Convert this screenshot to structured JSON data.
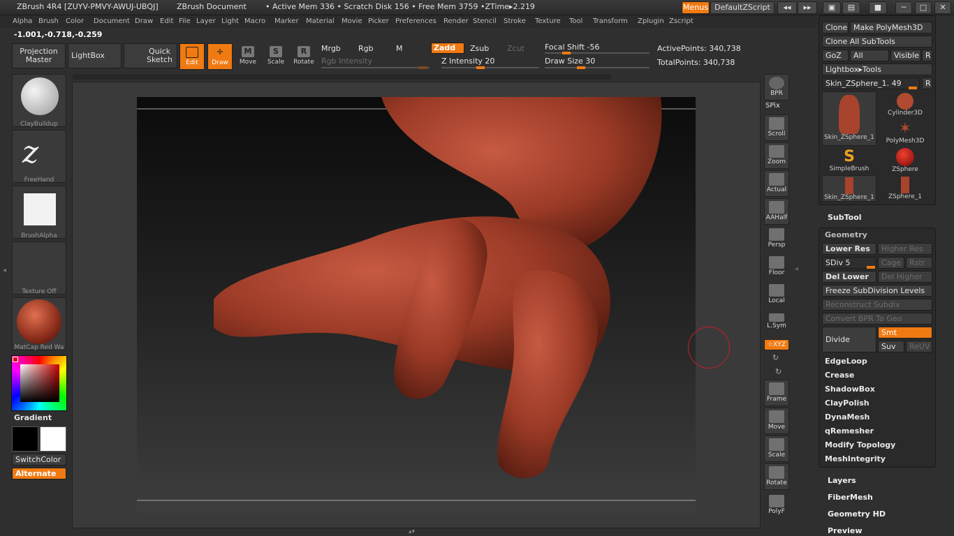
{
  "title": {
    "app": "ZBrush 4R4 [ZUYV-PMVY-AWUJ-UBQJ]",
    "doc": "ZBrush Document",
    "status": "• Active Mem 336 • Scratch Disk 156 • Free Mem 3759 •ZTime▸2.219"
  },
  "titlebar": {
    "menus": "Menus",
    "script": "DefaultZScript"
  },
  "menu": [
    "Alpha",
    "Brush",
    "Color",
    "Document",
    "Draw",
    "Edit",
    "File",
    "Layer",
    "Light",
    "Macro",
    "Marker",
    "Material",
    "Movie",
    "Picker",
    "Preferences",
    "Render",
    "Stencil",
    "Stroke",
    "Texture",
    "Tool",
    "Transform",
    "Zplugin",
    "Zscript"
  ],
  "coords": "-1.001,-0.718,-0.259",
  "toolbar": {
    "projection": "Projection Master",
    "lightbox": "LightBox",
    "quick_sketch": "Quick Sketch",
    "edit": "Edit",
    "draw": "Draw",
    "move": "Move",
    "scale": "Scale",
    "rotate": "Rotate",
    "mrgb": "Mrgb",
    "rgb": "Rgb",
    "m": "M",
    "zadd": "Zadd",
    "zsub": "Zsub",
    "zcut": "Zcut",
    "rgb_intensity": "Rgb Intensity",
    "z_intensity": "Z Intensity 20",
    "focal_shift": "Focal Shift -56",
    "draw_size": "Draw Size 30",
    "active_points": "ActivePoints: 340,738",
    "total_points": "TotalPoints: 340,738"
  },
  "left": {
    "brush": "ClayBuildup",
    "stroke": "FreeHand",
    "alpha": "BrushAlpha",
    "texture": "Texture Off",
    "material": "MatCap Red Wa",
    "gradient": "Gradient",
    "switch": "SwitchColor",
    "alternate": "Alternate"
  },
  "right": {
    "bpr": "BPR",
    "spix": "SPix",
    "scroll": "Scroll",
    "zoom": "Zoom",
    "actual": "Actual",
    "aahalf": "AAHalf",
    "persp": "Persp",
    "floor": "Floor",
    "local": "Local",
    "lsym": "L.Sym",
    "xyz": "☆XYZ",
    "frame": "Frame",
    "move": "Move",
    "scale": "Scale",
    "rotate": "Rotate",
    "polyf": "PolyF"
  },
  "tool": {
    "clone": "Clone",
    "make_polymesh": "Make PolyMesh3D",
    "clone_all": "Clone All SubTools",
    "goz": "GoZ",
    "all": "All",
    "visible": "Visible",
    "r": "R",
    "lightbox_tools": "Lightbox▸Tools",
    "current": "Skin_ZSphere_1. 49",
    "items": [
      "Skin_ZSphere_1",
      "Cylinder3D",
      "PolyMesh3D",
      "SimpleBrush",
      "ZSphere",
      "Skin_ZSphere_1",
      "ZSphere_1"
    ]
  },
  "subtool": "SubTool",
  "geometry": {
    "title": "Geometry",
    "lower_res": "Lower Res",
    "higher_res": "Higher Res",
    "sdiv": "SDiv 5",
    "cage": "Cage",
    "rstr": "Rstr",
    "del_lower": "Del Lower",
    "del_higher": "Del Higher",
    "freeze": "Freeze SubDivision Levels",
    "reconstruct": "Reconstruct Subdiv",
    "convert": "Convert BPR To Geo",
    "divide": "Divide",
    "smt": "Smt",
    "suv": "Suv",
    "reuv": "ReUV",
    "subs": [
      "EdgeLoop",
      "Crease",
      "ShadowBox",
      "ClayPolish",
      "DynaMesh",
      "qRemesher",
      "Modify Topology",
      "MeshIntegrity"
    ]
  },
  "more": [
    "Layers",
    "FiberMesh",
    "Geometry HD",
    "Preview"
  ],
  "colors": {
    "accent": "#f07a12",
    "skin": "#a8432e"
  }
}
